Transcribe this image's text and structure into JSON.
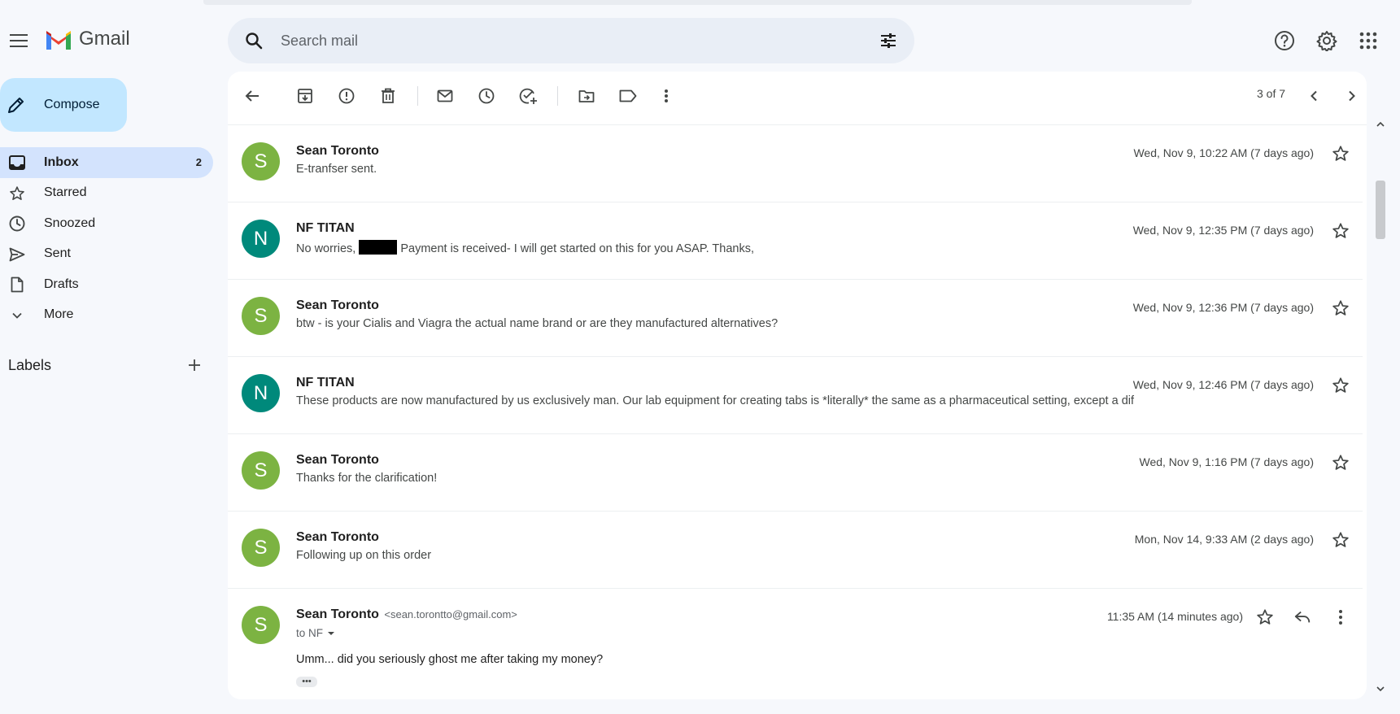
{
  "app": {
    "name": "Gmail"
  },
  "search": {
    "placeholder": "Search mail"
  },
  "compose": {
    "label": "Compose"
  },
  "nav": [
    {
      "label": "Inbox",
      "count": "2",
      "icon": "inbox-icon",
      "active": true
    },
    {
      "label": "Starred",
      "count": "",
      "icon": "star-icon"
    },
    {
      "label": "Snoozed",
      "count": "",
      "icon": "clock-icon"
    },
    {
      "label": "Sent",
      "count": "",
      "icon": "send-icon"
    },
    {
      "label": "Drafts",
      "count": "",
      "icon": "draft-icon"
    },
    {
      "label": "More",
      "count": "",
      "icon": "chevron-down-icon"
    }
  ],
  "labels": {
    "title": "Labels"
  },
  "toolbar": {
    "pager": "3 of 7"
  },
  "messages": [
    {
      "initial": "S",
      "avatar_color": "#7cb342",
      "sender": "Sean Toronto",
      "snippet": "E-tranfser sent.",
      "date": "Wed, Nov 9, 10:22 AM (7 days ago)"
    },
    {
      "initial": "N",
      "avatar_color": "#00897b",
      "sender": "NF TITAN",
      "snippet_pre": "No worries,",
      "snippet_post": "Payment is received- I will get started on this for you ASAP. Thanks,",
      "date": "Wed, Nov 9, 12:35 PM (7 days ago)"
    },
    {
      "initial": "S",
      "avatar_color": "#7cb342",
      "sender": "Sean Toronto",
      "snippet": "btw - is your Cialis and Viagra the actual name brand or are they manufactured alternatives?",
      "date": "Wed, Nov 9, 12:36 PM (7 days ago)"
    },
    {
      "initial": "N",
      "avatar_color": "#00897b",
      "sender": "NF TITAN",
      "snippet": "These products are now manufactured by us exclusively man. Our lab equipment for creating tabs is *literally* the same as a pharmaceutical setting, except a dif",
      "date": "Wed, Nov 9, 12:46 PM (7 days ago)"
    },
    {
      "initial": "S",
      "avatar_color": "#7cb342",
      "sender": "Sean Toronto",
      "snippet": "Thanks for the clarification!",
      "date": "Wed, Nov 9, 1:16 PM (7 days ago)"
    },
    {
      "initial": "S",
      "avatar_color": "#7cb342",
      "sender": "Sean Toronto",
      "snippet": "Following up on this order",
      "date": "Mon, Nov 14, 9:33 AM (2 days ago)"
    }
  ],
  "last_message": {
    "initial": "S",
    "avatar_color": "#7cb342",
    "sender": "Sean Toronto",
    "email": "<sean.torontto@gmail.com>",
    "to": "to NF",
    "date": "11:35 AM (14 minutes ago)",
    "body": "Umm... did you seriously ghost me after taking my money?",
    "dots": "•••"
  }
}
